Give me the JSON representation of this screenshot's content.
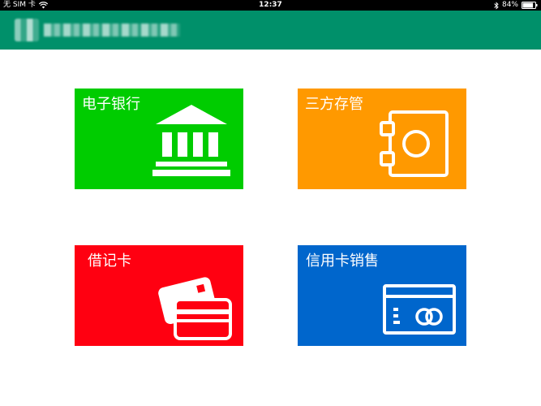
{
  "status_bar": {
    "carrier": "无 SIM 卡",
    "time": "12:37",
    "battery_percent": "84%",
    "battery_level": 0.84,
    "icons": [
      "wifi-icon",
      "bluetooth-icon",
      "battery-icon"
    ]
  },
  "colors": {
    "status_bar": "#000000",
    "header": "#00906a",
    "ebank_tile": "#00cc00",
    "custody_tile": "#ff9900",
    "debit_tile": "#ff0011",
    "credit_tile": "#0066cc"
  },
  "tiles": [
    {
      "label": "电子银行",
      "icon": "bank-icon"
    },
    {
      "label": "三方存管",
      "icon": "safe-icon"
    },
    {
      "label": "借记卡",
      "icon": "cards-icon"
    },
    {
      "label": "信用卡销售",
      "icon": "credit-card-icon"
    }
  ]
}
